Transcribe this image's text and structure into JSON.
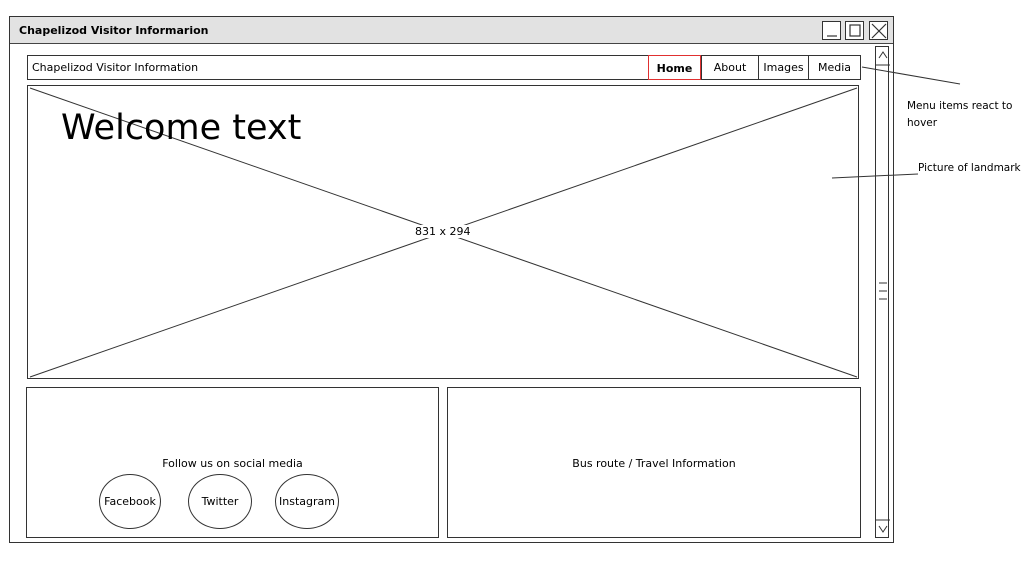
{
  "window": {
    "title": "Chapelizod Visitor Informarion",
    "controls": [
      "minimize-icon",
      "maximize-icon",
      "close-icon"
    ]
  },
  "navbar": {
    "site_title": "Chapelizod Visitor Information",
    "menu": [
      {
        "label": "Home",
        "active": true
      },
      {
        "label": "About",
        "active": false
      },
      {
        "label": "Images",
        "active": false
      },
      {
        "label": "Media",
        "active": false
      }
    ],
    "active_color": "#e03030"
  },
  "hero": {
    "heading": "Welcome text",
    "image_placeholder": "831 x 294"
  },
  "social": {
    "caption": "Follow us on social media",
    "buttons": [
      "Facebook",
      "Twitter",
      "Instagram"
    ]
  },
  "travel": {
    "caption": "Bus route / Travel Information"
  },
  "annotations": {
    "menu_note": "Menu items react to hover",
    "picture_note": "Picture of landmark"
  },
  "scrollbar": {
    "up": "chevron-up-icon",
    "down": "chevron-down-icon",
    "thumb": "grip-icon"
  }
}
